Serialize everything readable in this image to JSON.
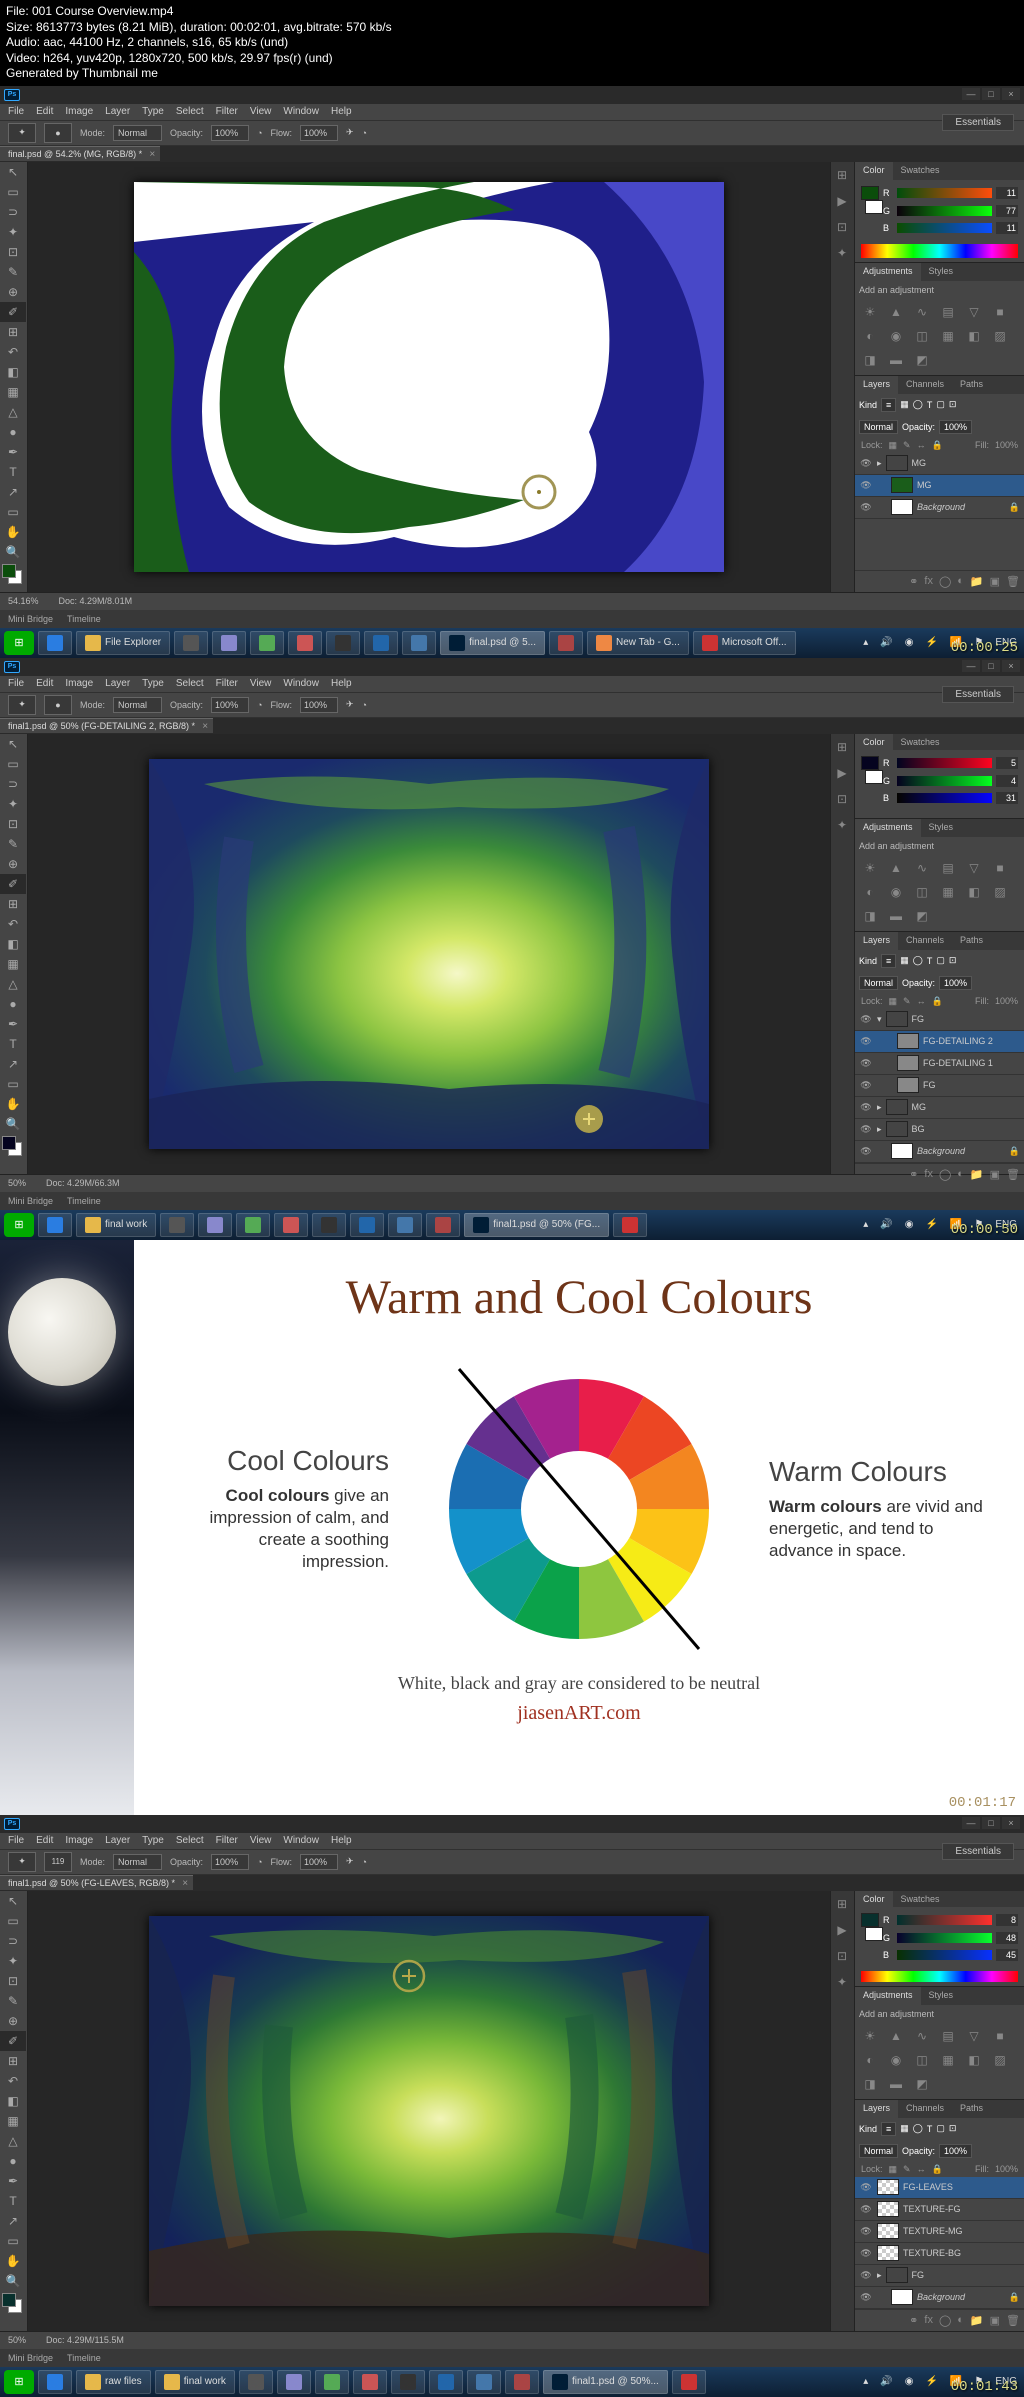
{
  "file_info": {
    "l1": "File: 001 Course Overview.mp4",
    "l2": "Size: 8613773 bytes (8.21 MiB), duration: 00:02:01, avg.bitrate: 570 kb/s",
    "l3": "Audio: aac, 44100 Hz, 2 channels, s16, 65 kb/s (und)",
    "l4": "Video: h264, yuv420p, 1280x720, 500 kb/s, 29.97 fps(r) (und)",
    "l5": "Generated by Thumbnail me"
  },
  "menu": {
    "file": "File",
    "edit": "Edit",
    "image": "Image",
    "layer": "Layer",
    "type": "Type",
    "select": "Select",
    "filter": "Filter",
    "view": "View",
    "window": "Window",
    "help": "Help"
  },
  "workspace": "Essentials",
  "options": {
    "mode_label": "Mode:",
    "mode_val": "Normal",
    "opacity_label": "Opacity:",
    "opacity_val": "100%",
    "flow_label": "Flow:",
    "flow_val": "100%",
    "brush_size": "119"
  },
  "shot1": {
    "tab": "final.psd @ 54.2% (MG, RGB/8) *",
    "zoom": "54.16%",
    "doc": "Doc: 4.29M/8.01M",
    "color_vals": {
      "r": "11",
      "g": "77",
      "b": "11"
    },
    "layers": [
      "MG",
      "MG",
      "Background"
    ],
    "taskbar": {
      "items": [
        "File Explorer",
        "final.psd @ 5...",
        "New Tab - G...",
        "Microsoft Off..."
      ],
      "lang": "ENG"
    },
    "adj_label": "Add an adjustment",
    "bottom_tabs": [
      "Mini Bridge",
      "Timeline"
    ],
    "timestamp": "00:00:25"
  },
  "shot2": {
    "tab": "final1.psd @ 50% (FG-DETAILING 2, RGB/8) *",
    "zoom": "50%",
    "doc": "Doc: 4.29M/66.3M",
    "color_vals": {
      "r": "5",
      "g": "4",
      "b": "31"
    },
    "layers": [
      "FG",
      "FG-DETAILING 2",
      "FG-DETAILING 1",
      "FG",
      "MG",
      "BG",
      "Background"
    ],
    "taskbar": {
      "items": [
        "final work",
        "final1.psd @ 50% (FG..."
      ],
      "lang": "ENG"
    },
    "adj_label": "Add an adjustment",
    "bottom_tabs": [
      "Mini Bridge",
      "Timeline"
    ],
    "timestamp": "00:00:50"
  },
  "slide": {
    "title": "Warm and Cool Colours",
    "cool_h": "Cool Colours",
    "cool_p": "Cool colours give an impression of calm, and create a soothing impression.",
    "warm_h": "Warm Colours",
    "warm_p": "Warm colours are vivid and energetic, and tend to advance in space.",
    "footer": "White, black and gray are considered to be neutral",
    "url": "jiasenART.com",
    "timestamp": "00:01:17"
  },
  "shot4": {
    "tab": "final1.psd @ 50% (FG-LEAVES, RGB/8) *",
    "zoom": "50%",
    "doc": "Doc: 4.29M/115.5M",
    "color_vals": {
      "r": "8",
      "g": "48",
      "b": "45"
    },
    "layers": [
      "FG-LEAVES",
      "TEXTURE-FG",
      "TEXTURE-MG",
      "TEXTURE-BG",
      "FG",
      "Background"
    ],
    "taskbar": {
      "items": [
        "raw files",
        "final work",
        "final1.psd @ 50%..."
      ],
      "lang": "ENG"
    },
    "adj_label": "Add an adjustment",
    "bottom_tabs": [
      "Mini Bridge",
      "Timeline"
    ],
    "timestamp": "00:01:43"
  },
  "panels": {
    "color": "Color",
    "swatches": "Swatches",
    "adjustments": "Adjustments",
    "styles": "Styles",
    "layers": "Layers",
    "channels": "Channels",
    "paths": "Paths",
    "normal": "Normal",
    "opacity": "Opacity:",
    "fill": "Fill:",
    "pct": "100%",
    "lock": "Lock:",
    "kind": "Kind"
  }
}
